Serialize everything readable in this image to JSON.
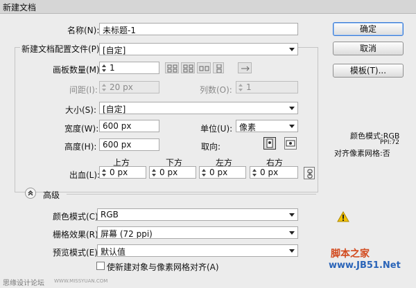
{
  "window": {
    "title": "新建文档"
  },
  "name": {
    "label": "名称(N):",
    "value": "未标题-1"
  },
  "profile": {
    "label": "新建文档配置文件(P):",
    "value": "[自定]"
  },
  "artboards": {
    "label": "画板数量(M):",
    "value": "1"
  },
  "spacing": {
    "label": "间距(I):",
    "value": "20 px"
  },
  "columns": {
    "label": "列数(O):",
    "value": "1"
  },
  "size": {
    "label": "大小(S):",
    "value": "[自定]"
  },
  "width": {
    "label": "宽度(W):",
    "value": "600 px"
  },
  "units": {
    "label": "单位(U):",
    "value": "像素"
  },
  "height": {
    "label": "高度(H):",
    "value": "600 px"
  },
  "orientation": {
    "label": "取向:"
  },
  "bleed": {
    "label": "出血(L):",
    "top": {
      "label": "上方",
      "value": "0 px"
    },
    "bottom": {
      "label": "下方",
      "value": "0 px"
    },
    "left": {
      "label": "左方",
      "value": "0 px"
    },
    "right": {
      "label": "右方",
      "value": "0 px"
    }
  },
  "advanced": {
    "label": "高级"
  },
  "color_mode": {
    "label": "颜色模式(C):",
    "value": "RGB"
  },
  "raster": {
    "label": "栅格效果(R):",
    "value": "屏幕 (72 ppi)"
  },
  "preview": {
    "label": "预览模式(E):",
    "value": "默认值"
  },
  "align_checkbox": {
    "label": "使新建对象与像素网格对齐(A)"
  },
  "buttons": {
    "ok": "确定",
    "cancel": "取消",
    "templates": "模板(T)..."
  },
  "info": {
    "color_mode": "颜色模式:RGB",
    "ppi": "PPI:72",
    "grid": "对齐像素网格:否"
  },
  "watermarks": {
    "left": "思缘设计论坛",
    "left_url": "WWW.MISSYUAN.COM",
    "right_top": "脚本之家",
    "right_bottom": "www.JB51.Net"
  },
  "colors": {
    "accent": "#3a7bd5",
    "warning": "#f2c200"
  }
}
